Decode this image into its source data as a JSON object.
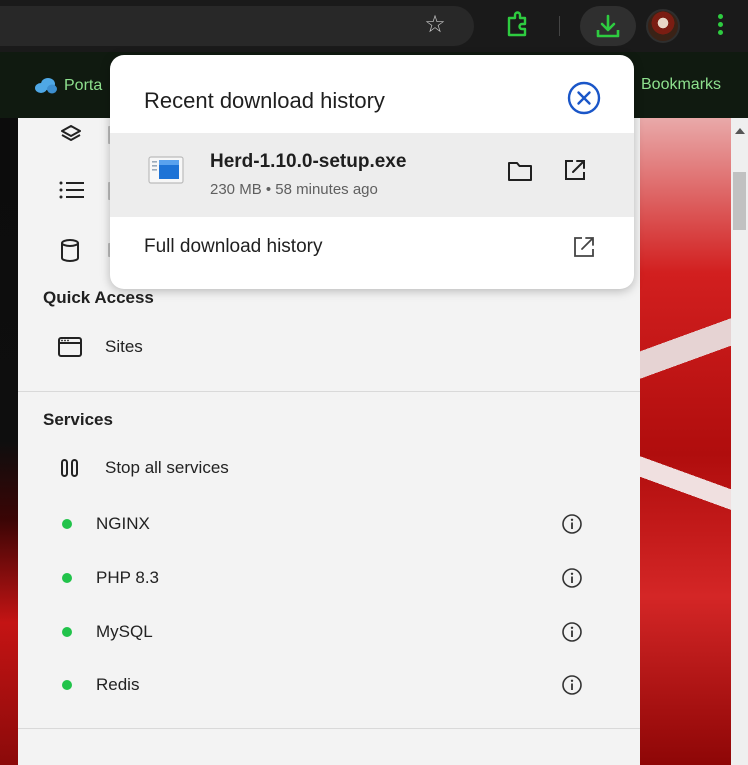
{
  "browser": {
    "bookmarks": [
      {
        "label": "Porta"
      },
      {
        "label": "Bookmarks"
      }
    ],
    "icons": [
      "star-icon",
      "extensions-icon",
      "download-icon",
      "profile-avatar",
      "menu-icon"
    ],
    "accent_color": "#2ecc40"
  },
  "download_popup": {
    "title": "Recent download history",
    "item": {
      "file_name": "Herd-1.10.0-setup.exe",
      "meta": "230 MB • 58 minutes ago"
    },
    "full_history_label": "Full download history"
  },
  "app": {
    "quick_access": {
      "title": "Quick Access",
      "items": [
        {
          "label": "Sites"
        }
      ]
    },
    "services": {
      "title": "Services",
      "stop_all_label": "Stop all services",
      "status_color": "#21c34a",
      "items": [
        {
          "label": "NGINX"
        },
        {
          "label": "PHP 8.3"
        },
        {
          "label": "MySQL"
        },
        {
          "label": "Redis"
        }
      ]
    }
  }
}
